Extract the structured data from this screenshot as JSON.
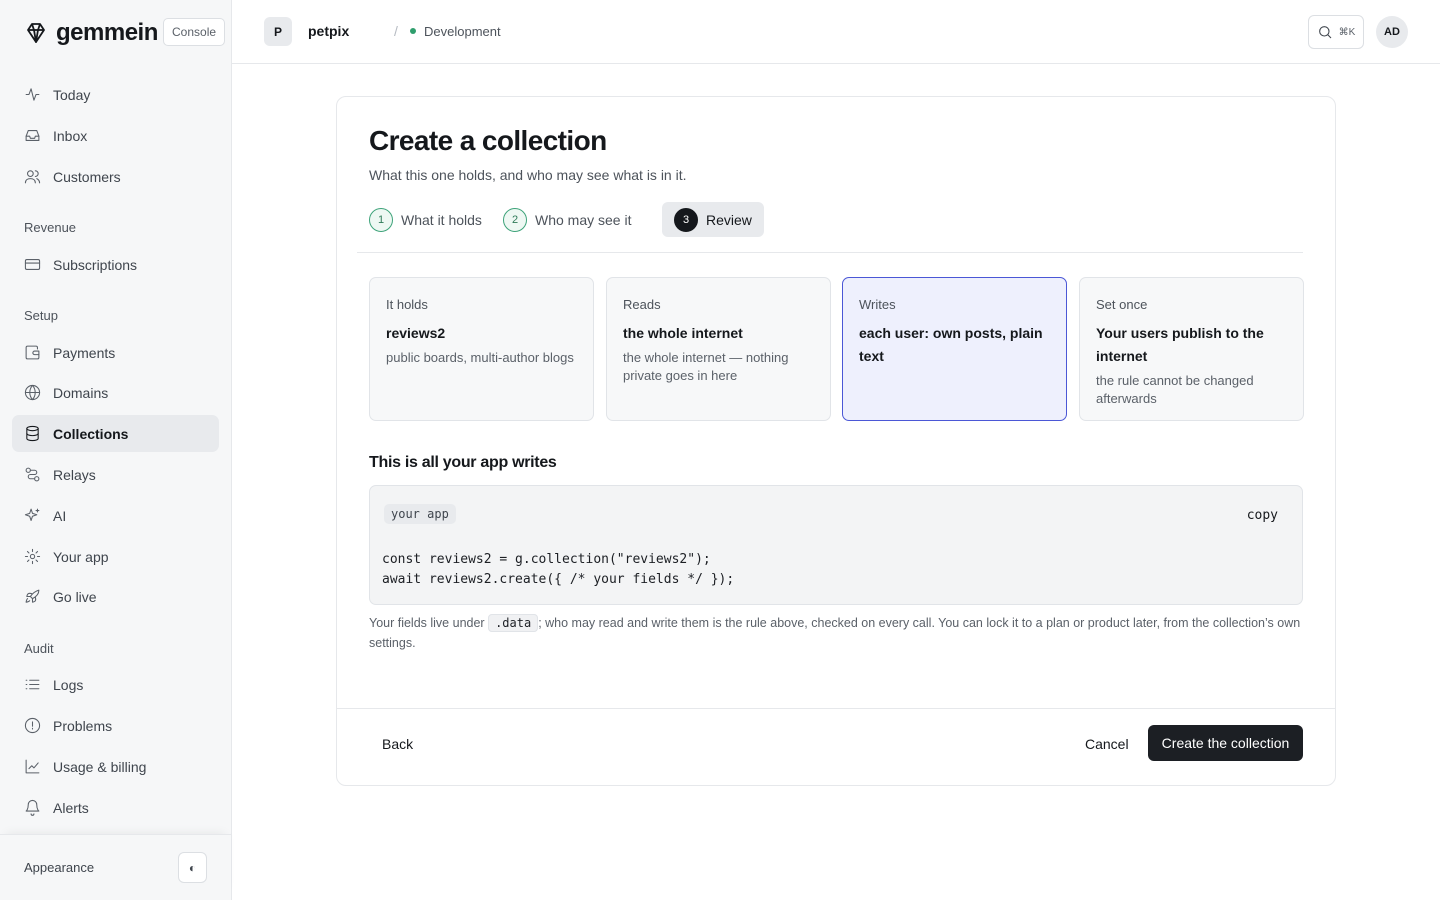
{
  "app": {
    "name": "gemmein",
    "badge": "Console"
  },
  "sidebar": {
    "items_top": [
      {
        "label": "Today",
        "icon": "activity-icon"
      },
      {
        "label": "Inbox",
        "icon": "inbox-icon"
      },
      {
        "label": "Customers",
        "icon": "users-icon"
      }
    ],
    "sections": [
      {
        "title": "Revenue",
        "items": [
          {
            "label": "Subscriptions",
            "icon": "credit-card-icon"
          }
        ]
      },
      {
        "title": "Setup",
        "items": [
          {
            "label": "Payments",
            "icon": "wallet-icon"
          },
          {
            "label": "Domains",
            "icon": "globe-icon"
          },
          {
            "label": "Collections",
            "icon": "database-icon",
            "active": true
          },
          {
            "label": "Relays",
            "icon": "route-icon"
          },
          {
            "label": "AI",
            "icon": "sparkles-icon"
          },
          {
            "label": "Your app",
            "icon": "gear-icon"
          },
          {
            "label": "Go live",
            "icon": "rocket-icon"
          }
        ]
      },
      {
        "title": "Audit",
        "items": [
          {
            "label": "Logs",
            "icon": "list-icon"
          },
          {
            "label": "Problems",
            "icon": "alert-circle-icon"
          },
          {
            "label": "Usage & billing",
            "icon": "chart-icon"
          },
          {
            "label": "Alerts",
            "icon": "bell-icon"
          }
        ]
      }
    ],
    "footer": {
      "appearance_label": "Appearance",
      "theme_glyph": "◐"
    }
  },
  "topbar": {
    "project_initial": "P",
    "project_name": "petpix",
    "separator": "/",
    "environment": "Development",
    "env_color": "#2f9e6d",
    "search_shortcut": "⌘K",
    "user_initials": "AD"
  },
  "page": {
    "title": "Create a collection",
    "subtitle": "What this one holds, and who may see what is in it.",
    "steps": [
      {
        "number": "1",
        "label": "What it holds"
      },
      {
        "number": "2",
        "label": "Who may see it"
      },
      {
        "number": "3",
        "label": "Review",
        "current": true
      }
    ],
    "summary": [
      {
        "label": "It holds",
        "value": "reviews2",
        "note": "public boards, multi-author blogs"
      },
      {
        "label": "Reads",
        "value": "the whole internet",
        "note": "the whole internet — nothing private goes in here"
      },
      {
        "label": "Writes",
        "value": "each user: own posts, plain text",
        "note": "",
        "highlighted": true
      },
      {
        "label": "Set once",
        "value": "Your users publish to the internet",
        "note": "the rule cannot be changed afterwards"
      }
    ],
    "code_heading": "This is all your app writes",
    "code": {
      "tag": "your app",
      "copy_label": "copy",
      "lines": [
        "const reviews2 = g.collection(\"reviews2\");",
        "await reviews2.create({ /* your fields */ });"
      ]
    },
    "note": {
      "before": "Your fields live under ",
      "code": ".data",
      "after": "; who may read and write them is the rule above, checked on every call. You can lock it to a plan or product later, from the collection’s own settings."
    },
    "footer": {
      "back": "Back",
      "cancel": "Cancel",
      "create": "Create the collection"
    }
  },
  "colors": {
    "accent_highlight_border": "#4b57d6",
    "primary_button": "#1c1f24",
    "step_done": "#3ea37a"
  }
}
